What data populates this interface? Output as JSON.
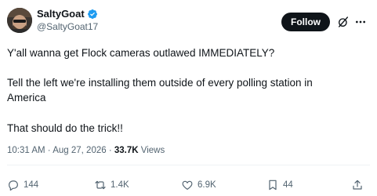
{
  "author": {
    "display_name": "SaltyGoat",
    "handle": "@SaltyGoat17",
    "verified": true,
    "verified_color": "#1d9bf0",
    "avatar_icon": "avatar-image"
  },
  "header": {
    "follow_label": "Follow",
    "grok_icon": "grok-icon",
    "more_icon": "more-icon"
  },
  "tweet": {
    "paragraphs": [
      "Y'all wanna get Flock cameras outlawed IMMEDIATELY?",
      "Tell the left we're installing them outside of every polling station in America",
      "That should do the trick!!"
    ]
  },
  "meta": {
    "time": "10:31 AM",
    "separator": "·",
    "date": "Aug 27, 2026",
    "views_count": "33.7K",
    "views_label": "Views"
  },
  "actions": {
    "reply": {
      "icon": "reply-icon",
      "count": "144"
    },
    "repost": {
      "icon": "repost-icon",
      "count": "1.4K"
    },
    "like": {
      "icon": "heart-icon",
      "count": "6.9K"
    },
    "bookmark": {
      "icon": "bookmark-icon",
      "count": "44"
    },
    "share": {
      "icon": "share-icon"
    }
  },
  "colors": {
    "text_primary": "#0f1419",
    "text_secondary": "#536471",
    "follow_bg": "#0f1419",
    "follow_text": "#ffffff"
  }
}
